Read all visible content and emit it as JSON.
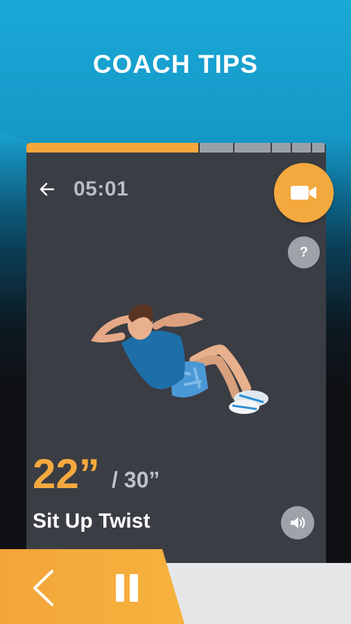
{
  "header": {
    "title": "COACH TIPS"
  },
  "workout": {
    "timer": "05:01",
    "current_seconds": "22”",
    "total_seconds": "/ 30”",
    "exercise_name": "Sit Up Twist",
    "help_label": "?"
  },
  "progress": {
    "completed_fraction": 0.58,
    "segments": 6
  },
  "colors": {
    "accent": "#f4a93e",
    "panel": "#3b3d44",
    "sky": "#1aa9d8"
  },
  "icons": {
    "back": "back-arrow-icon",
    "video": "video-camera-icon",
    "help": "question-icon",
    "sound": "speaker-icon",
    "prev": "chevron-left-icon",
    "pause": "pause-icon"
  }
}
